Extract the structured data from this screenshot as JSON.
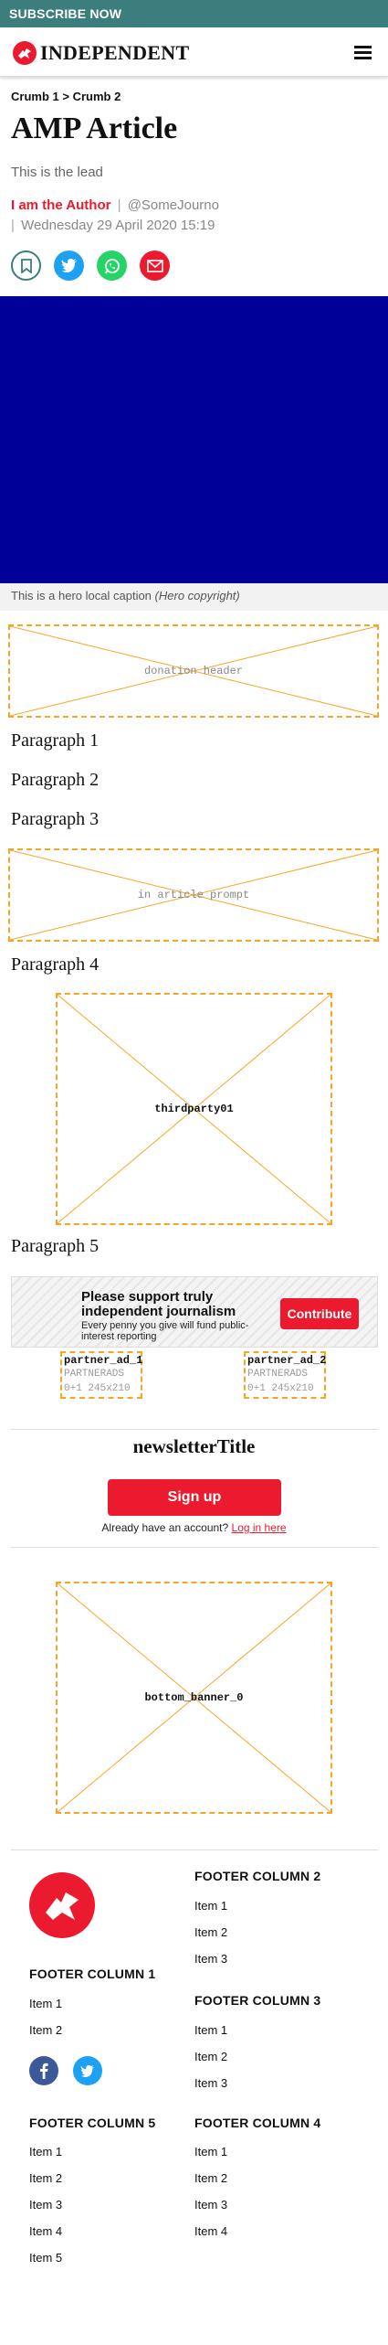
{
  "topbar": {
    "subscribe_label": "SUBSCRIBE NOW",
    "color": "#3c7d7e"
  },
  "header": {
    "logo_text": "INDEPENDENT",
    "brand_color": "#ec1a2e"
  },
  "article": {
    "breadcrumbs": [
      "Crumb 1",
      "Crumb 2"
    ],
    "breadcrumb_separator": ">",
    "title": "AMP Article",
    "lead": "This is the lead",
    "author": "I am the Author",
    "author_handle": "@SomeJourno",
    "date": "Wednesday 29 April 2020 15:19",
    "byline_separator": "|",
    "share_icons": [
      "bookmark-icon",
      "twitter-icon",
      "whatsapp-icon",
      "email-icon"
    ],
    "hero_color": "#000099",
    "hero_caption": "This is a hero local caption",
    "hero_copyright": "(Hero copyright)",
    "paragraphs": [
      "Paragraph 1",
      "Paragraph 2",
      "Paragraph 3",
      "Paragraph 4",
      "Paragraph 5"
    ]
  },
  "placeholders": {
    "donation_header": "donation header",
    "in_article_prompt": "in article prompt",
    "thirdparty": "thirdparty01",
    "bottom_banner": "bottom_banner_0"
  },
  "donation": {
    "headline": "Please support truly independent journalism",
    "subtext": "Every penny you give will fund public-interest reporting",
    "button_label": "Contribute"
  },
  "partner_ads": [
    {
      "name": "partner_ad_1",
      "network": "PARTNERADS",
      "size": "0+1 245x210"
    },
    {
      "name": "partner_ad_2",
      "network": "PARTNERADS",
      "size": "0+1 245x210"
    }
  ],
  "newsletter": {
    "title": "newsletterTitle",
    "signup_label": "Sign up",
    "already_text": "Already have an account?",
    "login_link": "Log in here"
  },
  "footer": {
    "column1": {
      "title": "FOOTER COLUMN 1",
      "items": [
        "Item 1",
        "Item 2"
      ]
    },
    "column2": {
      "title": "FOOTER COLUMN 2",
      "items": [
        "Item 1",
        "Item 2",
        "Item 3"
      ]
    },
    "column3": {
      "title": "FOOTER COLUMN 3",
      "items": [
        "Item 1",
        "Item 2",
        "Item 3"
      ]
    },
    "column4": {
      "title": "FOOTER COLUMN 4",
      "items": [
        "Item 1",
        "Item 2",
        "Item 3",
        "Item 4"
      ]
    },
    "column5": {
      "title": "FOOTER COLUMN 5",
      "items": [
        "Item 1",
        "Item 2",
        "Item 3",
        "Item 4",
        "Item 5"
      ]
    },
    "social_icons": [
      "facebook-icon",
      "twitter-icon"
    ]
  }
}
